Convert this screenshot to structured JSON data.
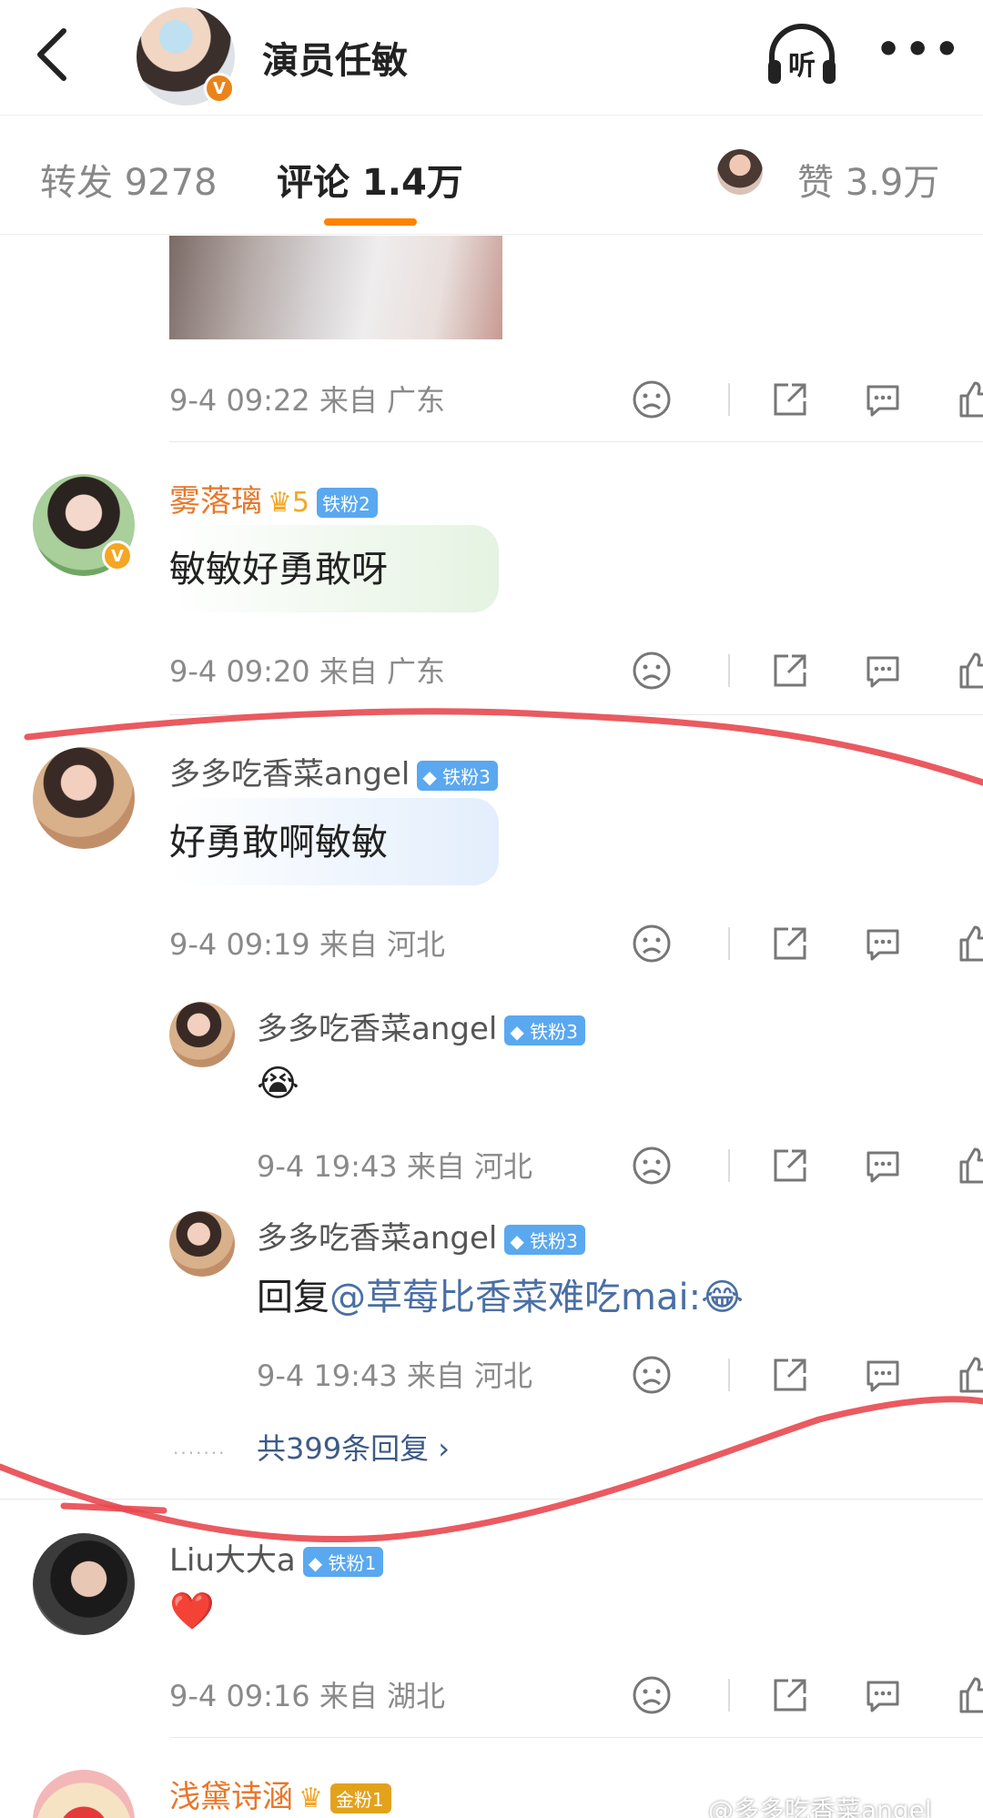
{
  "header": {
    "title": "演员任敏",
    "listen_label": "听",
    "more_label": "•••"
  },
  "tabs": {
    "repost": "转发 9278",
    "comments": "评论 1.4万",
    "likes": "赞 3.9万"
  },
  "colors": {
    "accent_orange": "#ff8200",
    "username_orange": "#e8772a",
    "link_blue": "#4a6fa5",
    "annotation_red": "#e8484f"
  },
  "comments": [
    {
      "meta": "9-4 09:22  来自 广东"
    },
    {
      "username": "雾落璃",
      "crown": "♛5",
      "badge": "铁粉2",
      "text": "敏敏好勇敢呀",
      "meta": "9-4 09:20  来自 广东"
    },
    {
      "username": "多多吃香菜angel",
      "badge": "◆ 铁粉3",
      "text": "好勇敢啊敏敏",
      "meta": "9-4 09:19  来自 河北",
      "replies": [
        {
          "username": "多多吃香菜angel",
          "badge": "◆ 铁粉3",
          "emoji": "😭",
          "meta": "9-4 19:43  来自 河北"
        },
        {
          "username": "多多吃香菜angel",
          "badge": "◆ 铁粉3",
          "reply_prefix": "回复",
          "mention": "@草莓比香菜难吃mai",
          "emoji": ":😂",
          "meta": "9-4 19:43  来自 河北"
        }
      ],
      "more_replies": "共399条回复 ›"
    },
    {
      "username": "Liu大大a",
      "badge": "◆ 铁粉1",
      "emoji": "❤️",
      "meta": "9-4 09:16  来自 湖北"
    },
    {
      "username": "浅黛诗涵",
      "crown": "♛",
      "badge": "金粉1"
    }
  ],
  "watermark": "@多多吃香菜angel",
  "icons": [
    "back-arrow-icon",
    "listen-headphone-icon",
    "more-icon",
    "dislike-face-icon",
    "share-icon",
    "comment-icon",
    "like-thumb-icon",
    "verified-v-icon"
  ]
}
